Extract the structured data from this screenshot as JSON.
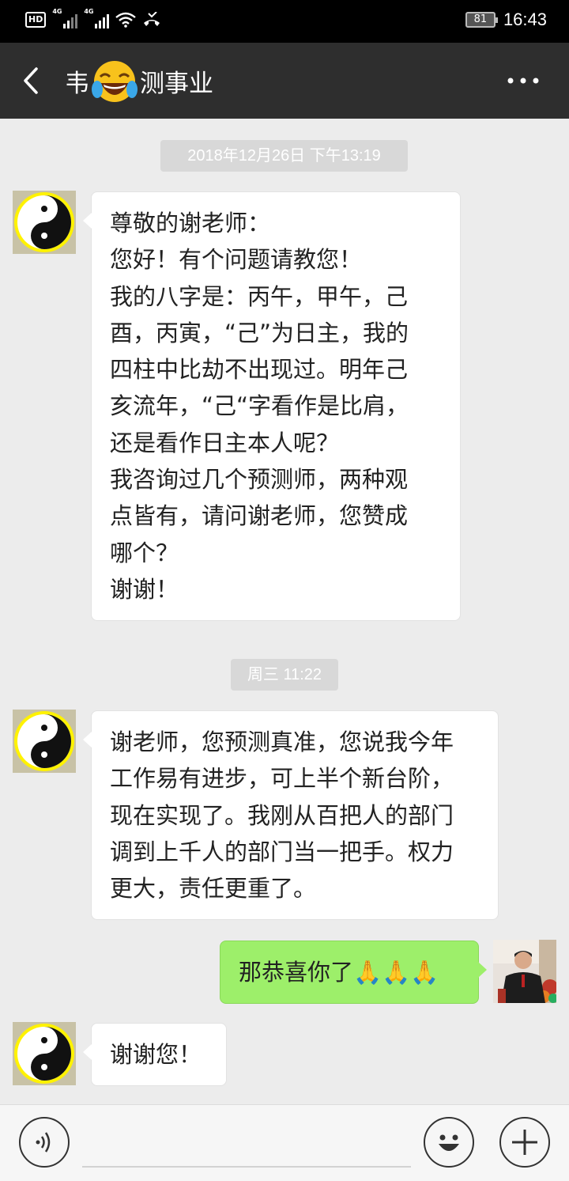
{
  "status_bar": {
    "hd": "HD",
    "net1": "4G",
    "net2": "4G",
    "battery": "81",
    "time": "16:43"
  },
  "nav": {
    "title_left": "韦",
    "title_right": "测事业"
  },
  "messages": {
    "ts1": "2018年12月26日 下午13:19",
    "m1_lines": [
      "尊敬的谢老师：",
      "您好！有个问题请教您！",
      "我的八字是：丙午，甲午，己",
      "酉，丙寅，“己”为日主，我的",
      "四柱中比劫不出现过。明年己",
      "亥流年，“己“字看作是比肩，",
      "还是看作日主本人呢？",
      "我咨询过几个预测师，两种观",
      "点皆有，请问谢老师，您赞成",
      "哪个？",
      "谢谢！"
    ],
    "ts2": "周三 11:22",
    "m2_lines": [
      "谢老师，您预测真准，您说我今年",
      "工作易有进步，可上半个新台阶，",
      "现在实现了。我刚从百把人的部门",
      "调到上千人的部门当一把手。权力",
      "更大，责任更重了。"
    ],
    "m3": "那恭喜你了🙏🙏🙏",
    "m4": "谢谢您！"
  },
  "icons": {
    "back": "chevron-left-icon",
    "more": "more-dots-icon",
    "voice": "voice-icon",
    "emoji": "emoji-icon",
    "plus": "plus-icon"
  },
  "colors": {
    "nav_bg": "#2e2e2e",
    "chat_bg": "#ececec",
    "my_bubble": "#9def6a",
    "their_bubble": "#ffffff"
  }
}
